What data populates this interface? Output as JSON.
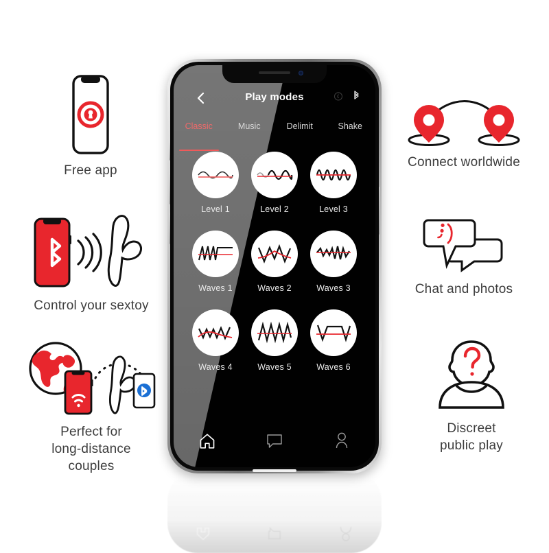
{
  "brand": {
    "red": "#e8262d",
    "accent_pink": "#ef5a5a",
    "caption_color": "#3d3d3d",
    "bluetooth_blue": "#1a6fd4"
  },
  "features_left": [
    {
      "id": "free-app",
      "caption": "Free app",
      "icon": "phone-with-lock-icon"
    },
    {
      "id": "control",
      "caption": "Control your sextoy",
      "icon": "phone-bluetooth-toy-icon"
    },
    {
      "id": "long-dist",
      "caption": "Perfect for\nlong-distance\ncouples",
      "icon": "globe-phone-toy-icon"
    }
  ],
  "features_right": [
    {
      "id": "connect",
      "caption": "Connect worldwide",
      "icon": "map-pins-arc-icon"
    },
    {
      "id": "chat",
      "caption": "Chat and photos",
      "icon": "speech-bubbles-wink-icon"
    },
    {
      "id": "discreet",
      "caption": "Discreet\npublic play",
      "icon": "anonymous-person-icon"
    }
  ],
  "phone": {
    "app": {
      "back_icon": "chevron-left-icon",
      "title": "Play modes",
      "status_icons": [
        "toy-battery-icon",
        "bluetooth-icon"
      ],
      "tabs": [
        {
          "label": "Classic",
          "active": true
        },
        {
          "label": "Music",
          "active": false
        },
        {
          "label": "Delimit",
          "active": false
        },
        {
          "label": "Shake",
          "active": false
        }
      ],
      "modes": [
        {
          "label": "Level 1",
          "wave": "sine-low-amplitude"
        },
        {
          "label": "Level 2",
          "wave": "sine-rising-amplitude"
        },
        {
          "label": "Level 3",
          "wave": "sine-high-frequency"
        },
        {
          "label": "Waves 1",
          "wave": "sawtooth-then-flat"
        },
        {
          "label": "Waves 2",
          "wave": "triangle-peak"
        },
        {
          "label": "Waves 3",
          "wave": "mixed-spikes"
        },
        {
          "label": "Waves 4",
          "wave": "zigzag-descending"
        },
        {
          "label": "Waves 5",
          "wave": "triangle-train"
        },
        {
          "label": "Waves 6",
          "wave": "square-plateau"
        }
      ],
      "nav": [
        {
          "label": "Home",
          "icon": "home-icon"
        },
        {
          "label": "Chat",
          "icon": "speech-bubble-icon"
        },
        {
          "label": "Profile",
          "icon": "person-icon"
        }
      ]
    }
  }
}
